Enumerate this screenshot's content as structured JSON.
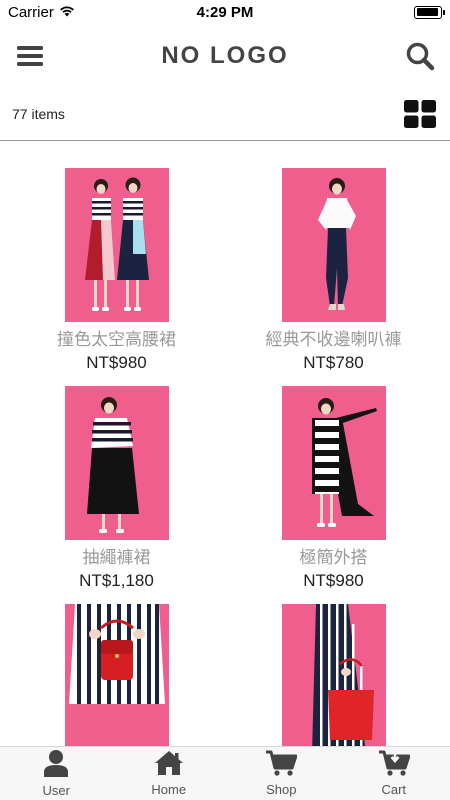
{
  "status_bar": {
    "carrier": "Carrier",
    "time": "4:29 PM",
    "battery_level": 0.95
  },
  "header": {
    "logo": "NO LOGO",
    "menu_icon": "hamburger-menu-icon",
    "search_icon": "search-icon"
  },
  "subheader": {
    "items_count": "77 items",
    "view_toggle_icon": "grid-view-icon"
  },
  "products": [
    {
      "name": "撞色太空高腰裙",
      "price": "NT$980"
    },
    {
      "name": "經典不收邊喇叭褲",
      "price": "NT$780"
    },
    {
      "name": "抽繩褲裙",
      "price": "NT$1,180"
    },
    {
      "name": "極簡外搭",
      "price": "NT$980"
    },
    {
      "name": "",
      "price": ""
    },
    {
      "name": "",
      "price": ""
    }
  ],
  "tabbar": {
    "items": [
      {
        "label": "User",
        "icon": "user-icon"
      },
      {
        "label": "Home",
        "icon": "home-icon"
      },
      {
        "label": "Shop",
        "icon": "shopping-cart-icon"
      },
      {
        "label": "Cart",
        "icon": "cart-download-icon"
      }
    ]
  },
  "colors": {
    "photo_background": "#ef5e8d",
    "text_primary": "#222222",
    "text_muted": "#9a9a9a",
    "logo": "#444444"
  }
}
